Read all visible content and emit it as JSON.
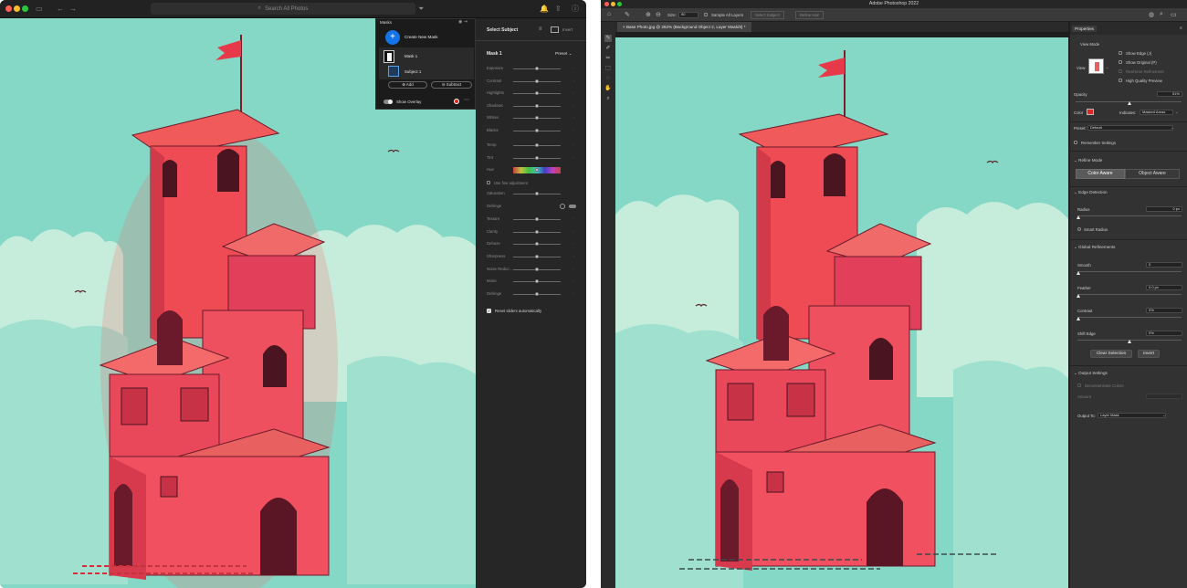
{
  "lightroom": {
    "search_placeholder": "Search All Photos",
    "masks_panel": {
      "title": "Masks",
      "create_new_mask": "Create New Mask",
      "mask_name": "Mask 1",
      "subject_name": "Subject 1",
      "add_label": "Add",
      "subtract_label": "Subtract",
      "show_overlay_label": "Show Overlay",
      "overlay_color": "#e0241f"
    },
    "edit_panel": {
      "header": "Select Subject",
      "invert_label": "Invert",
      "mask_title": "Mask 1",
      "preset_label": "Preset",
      "sliders": [
        {
          "label": "Exposure",
          "value": 0.5
        },
        {
          "label": "Contrast",
          "value": 0.5
        },
        {
          "label": "Highlights",
          "value": 0.5
        },
        {
          "label": "Shadows",
          "value": 0.5
        },
        {
          "label": "Whites",
          "value": 0.5
        },
        {
          "label": "Blacks",
          "value": 0.5
        }
      ],
      "color_sliders": [
        {
          "label": "Temp",
          "value": 0.5
        },
        {
          "label": "Tint",
          "value": 0.5
        }
      ],
      "hue_label": "Hue",
      "fine_adjustment_label": "Use fine adjustment",
      "saturation_label": "Saturation",
      "defringe_label": "Defringe",
      "effect_sliders": [
        {
          "label": "Texture",
          "value": 0.5
        },
        {
          "label": "Clarity",
          "value": 0.5
        },
        {
          "label": "Dehaze",
          "value": 0.5
        }
      ],
      "detail_sliders": [
        {
          "label": "Sharpness",
          "value": 0.5
        },
        {
          "label": "Noise Reduc...",
          "value": 0.5
        },
        {
          "label": "Moire",
          "value": 0.5
        },
        {
          "label": "Defringe",
          "value": 0.5
        }
      ],
      "reset_label": "Reset sliders automatically"
    }
  },
  "photoshop": {
    "app_title": "Adobe Photoshop 2022",
    "options_bar": {
      "size_label": "Size:",
      "size_value": "90",
      "sample_all_layers": "Sample All Layers",
      "select_subject": "Select Subject",
      "refine_hair": "Refine Hair"
    },
    "doc_tab": "Base Photo.jpg @ 282% (Background Object 2, Layer Mask/8) *",
    "properties": {
      "title": "Properties",
      "view_mode_label": "View Mode",
      "view_label": "View:",
      "show_edge": "Show Edge (J)",
      "show_original": "Show Original (P)",
      "realtime_refinement": "Real-time Refinement",
      "high_quality_preview": "High Quality Preview",
      "opacity_label": "Opacity",
      "opacity_value": "51%",
      "opacity_level": 0.51,
      "color_label": "Color",
      "color_swatch": "#e0241f",
      "indicates_label": "Indicates:",
      "indicates_value": "Masked Areas",
      "preset_label": "Preset:",
      "preset_value": "Default",
      "remember_settings": "Remember Settings",
      "refine_mode_title": "Refine Mode",
      "color_aware": "Color Aware",
      "object_aware": "Object Aware",
      "edge_detection_title": "Edge Detection",
      "radius_label": "Radius",
      "radius_value": "0 px",
      "smart_radius": "Smart Radius",
      "global_refinements_title": "Global Refinements",
      "smooth_label": "Smooth",
      "smooth_value": "0",
      "feather_label": "Feather",
      "feather_value": "0.0 px",
      "contrast_label": "Contrast",
      "contrast_value": "0%",
      "shift_edge_label": "Shift Edge",
      "shift_edge_value": "0%",
      "clear_selection": "Clear Selection",
      "invert": "Invert",
      "output_settings_title": "Output Settings",
      "decontaminate_colors": "Decontaminate Colors",
      "amount_label": "Amount",
      "output_to_label": "Output To:",
      "output_to_value": "Layer Mask"
    }
  }
}
